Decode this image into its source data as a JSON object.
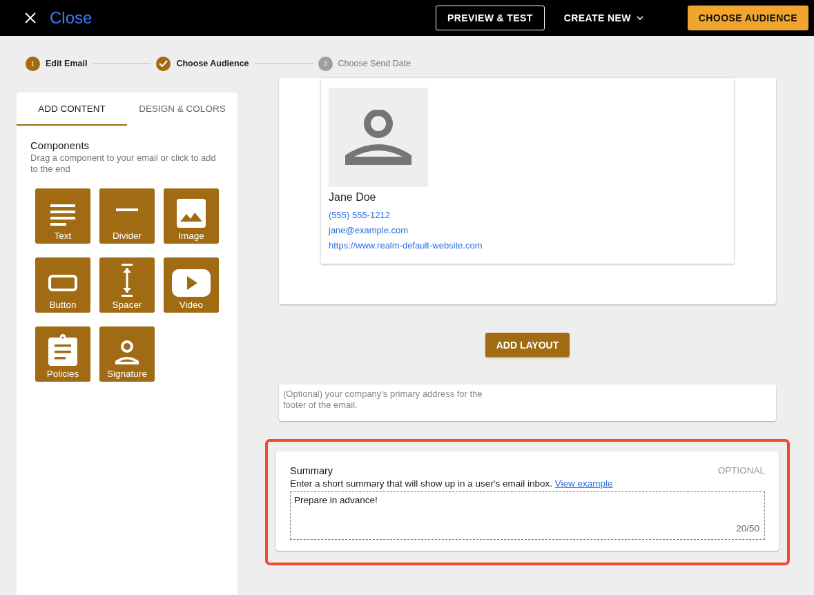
{
  "header": {
    "close_label": "Close",
    "buttons": [
      {
        "label": "PREVIEW & TEST",
        "kind": "outlined"
      },
      {
        "label": "CREATE NEW",
        "kind": "menu"
      },
      {
        "label": "CHOOSE AUDIENCE",
        "kind": "primary"
      }
    ]
  },
  "stepper": [
    {
      "number": "1",
      "label": "Edit Email",
      "done": false,
      "disabled": false
    },
    {
      "label": "Choose Audience",
      "done": true,
      "disabled": false
    },
    {
      "number": "3",
      "label": "Choose Send Date",
      "done": false,
      "disabled": true
    }
  ],
  "sidebar": {
    "tabs": [
      {
        "label": "ADD CONTENT",
        "selected": true
      },
      {
        "label": "DESIGN & COLORS",
        "selected": false
      }
    ],
    "title": "Components",
    "description": "Drag a component to your email or click to add to the end",
    "components": [
      {
        "label": "Text",
        "kind": "text"
      },
      {
        "label": "Divider",
        "kind": "divider"
      },
      {
        "label": "Image",
        "kind": "image"
      },
      {
        "label": "Button",
        "kind": "button"
      },
      {
        "label": "Spacer",
        "kind": "spacer"
      },
      {
        "label": "Video",
        "kind": "video"
      },
      {
        "label": "Policies",
        "kind": "policies"
      },
      {
        "label": "Signature",
        "kind": "signature"
      }
    ]
  },
  "signature": {
    "name": "Jane Doe",
    "links": [
      "(555) 555-1212",
      "jane@example.com",
      "https://www.realm-default-website.com"
    ]
  },
  "add_layout": "ADD LAYOUT",
  "address": {
    "placeholder": "(Optional) your company's primary address for the footer of the email."
  },
  "summary": {
    "highlighted": true,
    "title": "Summary",
    "optional": "OPTIONAL",
    "description": "Enter a short summary that will show up in a user's email inbox.",
    "link": "View example",
    "value": "Prepare in advance!",
    "counter": "20/50"
  }
}
